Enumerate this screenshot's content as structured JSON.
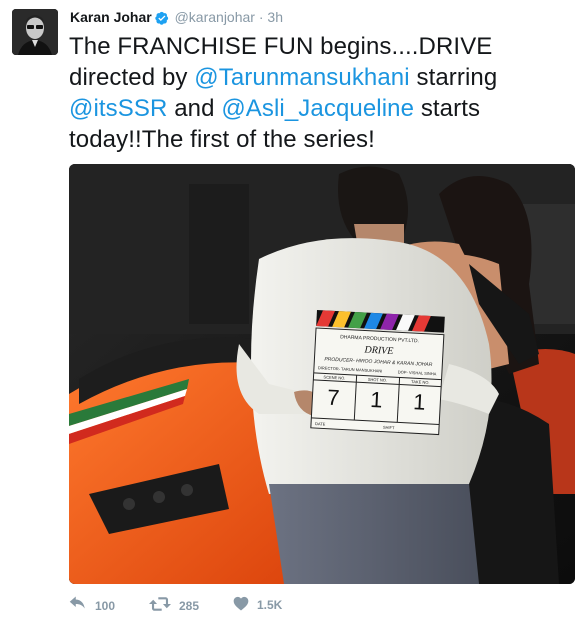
{
  "tweet": {
    "author_name": "Karan Johar",
    "handle": "@karanjohar",
    "separator": "·",
    "time": "3h",
    "text_parts": [
      {
        "type": "text",
        "value": "The FRANCHISE FUN begins....DRIVE directed by "
      },
      {
        "type": "mention",
        "value": "@Tarunmansukhani"
      },
      {
        "type": "text",
        "value": " starring "
      },
      {
        "type": "mention",
        "value": "@itsSSR"
      },
      {
        "type": "text",
        "value": " and "
      },
      {
        "type": "mention",
        "value": "@Asli_Jacqueline"
      },
      {
        "type": "text",
        "value": " starts today!!The first of the series!"
      }
    ]
  },
  "media": {
    "clapboard": {
      "production": "DHARMA PRODUCTION PVT.LTD.",
      "title": "DRIVE",
      "producer": "PRODUCER- HIROO JOHAR & KARAN JOHAR",
      "director": "DIRECTOR- TARUN MANSUKHANI",
      "dop": "DOP- VISHAL SINHA",
      "col_scene": "SCENE NO.",
      "col_shot": "SHOT NO.",
      "col_take": "TAKE NO.",
      "scene": "7",
      "shot": "1",
      "take": "1",
      "date_label": "DATE",
      "shift_label": "SHIFT"
    }
  },
  "actions": {
    "reply_count": "100",
    "retweet_count": "285",
    "like_count": "1.5K"
  },
  "colors": {
    "mention": "#1b95e0",
    "verified": "#1da1f2",
    "meta": "#8899a6",
    "car": "#f25a18"
  },
  "icons": [
    "verified-badge-icon",
    "reply-icon",
    "retweet-icon",
    "like-icon"
  ]
}
